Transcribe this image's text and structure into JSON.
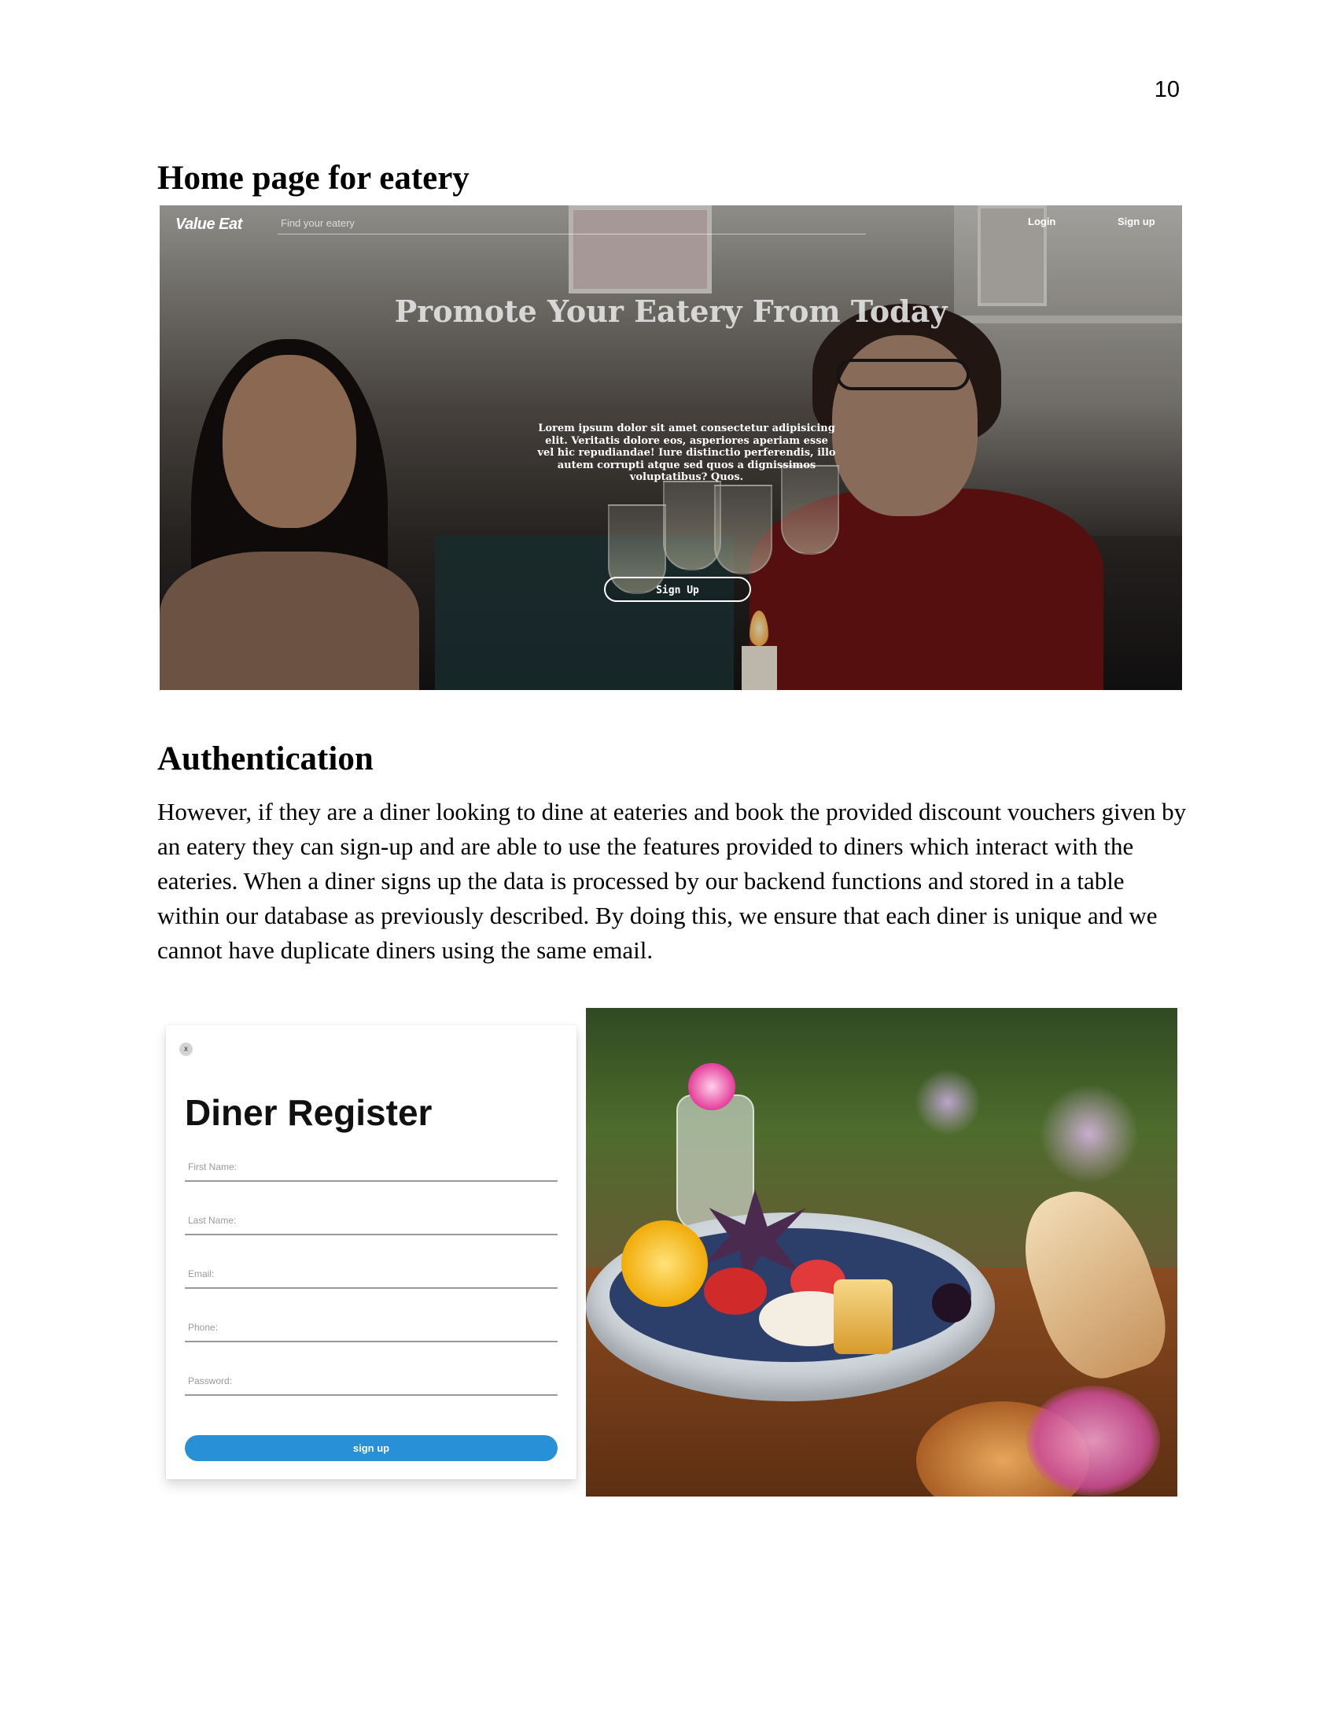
{
  "page": {
    "number": "10"
  },
  "sections": {
    "home_heading": "Home page for eatery",
    "auth_heading": "Authentication",
    "auth_paragraph": "However, if they are a diner looking to dine at eateries and book the provided discount vouchers given by an eatery they can sign-up and are able to use the features provided to diners which interact with the eateries. When a diner signs up the data is processed by our backend functions and stored in a table within our database as previously described. By doing this, we ensure that each diner is unique and we cannot have duplicate diners using the same email."
  },
  "home_screenshot": {
    "logo": "Value Eat",
    "search_placeholder": "Find your eatery",
    "nav": {
      "login": "Login",
      "signup": "Sign up"
    },
    "hero_title": "Promote Your Eatery From Today",
    "hero_text": "Lorem ipsum dolor sit amet consectetur adipisicing elit. Veritatis dolore eos, asperiores aperiam esse vel hic repudiandae! Iure distinctio perferendis, illo autem corrupti atque sed quos a dignissimos voluptatibus? Quos.",
    "hero_button": "Sign Up"
  },
  "register_screenshot": {
    "close_label": "x",
    "title": "Diner Register",
    "fields": {
      "first_name": "First Name:",
      "last_name": "Last Name:",
      "email": "Email:",
      "phone": "Phone:",
      "password": "Password:"
    },
    "submit": "sign up"
  }
}
